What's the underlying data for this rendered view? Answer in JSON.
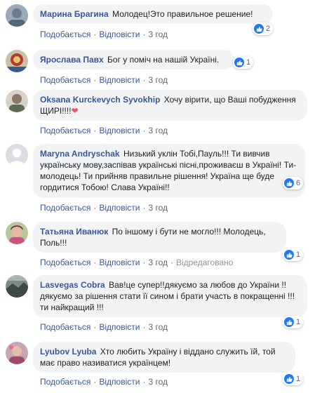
{
  "comments": [
    {
      "author": "Марина Брагина",
      "text": "Молодец!Это правильное решение!",
      "like_label": "Подобається",
      "reply_label": "Відповісти",
      "time": "3 год",
      "reactions": "2",
      "avatar_color": "#7a8fa6"
    },
    {
      "author": "Ярослава Павх",
      "text": "Бог у поміч на нашій Україні.",
      "like_label": "Подобається",
      "reply_label": "Відповісти",
      "time": "3 год",
      "reactions": "1",
      "avatar_color": "#b23a2e"
    },
    {
      "author": "Oksana Kurckevych Syvokhip",
      "text": "Хочу вірити, що Ваші побудження ЩИРІ!!!!",
      "emoji": "❤",
      "like_label": "Подобається",
      "reply_label": "Відповісти",
      "time": "3 год",
      "avatar_color": "#8a7866"
    },
    {
      "author": "Maryna Andryschak",
      "text": "Низький уклін Тобі,Пауль!!! Ти вивчив українську мову,заспівав українські пісні,проживаєш в Україні! Ти-молодець! Ти прийняв правильне рішення! Україна ще буде гордитися Тобою! Слава Україні!!",
      "like_label": "Подобається",
      "reply_label": "Відповісти",
      "time": "3 год",
      "reactions": "6",
      "avatar_color": "#d8dade"
    },
    {
      "author": "Татьяна Иванюк",
      "text": "По іншому і бути не могло!!! Молодець, Поль!!!",
      "like_label": "Подобається",
      "reply_label": "Відповісти",
      "time": "3 год",
      "edited": "Відредаговано",
      "reactions": "1",
      "avatar_color": "#c9557c"
    },
    {
      "author": "Lasvegas Cobra",
      "text": "Вав!це супер!!дякуємо за любов до України !!дякуємо за рішення стати її сином і брати участь в покращенні !!!ти найкращий !!!",
      "like_label": "Подобається",
      "reply_label": "Відповісти",
      "time": "3 год",
      "reactions": "1",
      "avatar_color": "#4e5a52"
    },
    {
      "author": "Lyubov Lyuba",
      "text": "Хто любить Україну і віддано служить їй, той має право називатися українцем!",
      "like_label": "Подобається",
      "reply_label": "Відповісти",
      "time": "3 год",
      "reactions": "1",
      "avatar_color": "#9c4a6a"
    }
  ],
  "colors": {
    "author": "#385898",
    "bubble": "#f2f3f5",
    "like_blue": "#2078f4",
    "meta": "#606770"
  }
}
